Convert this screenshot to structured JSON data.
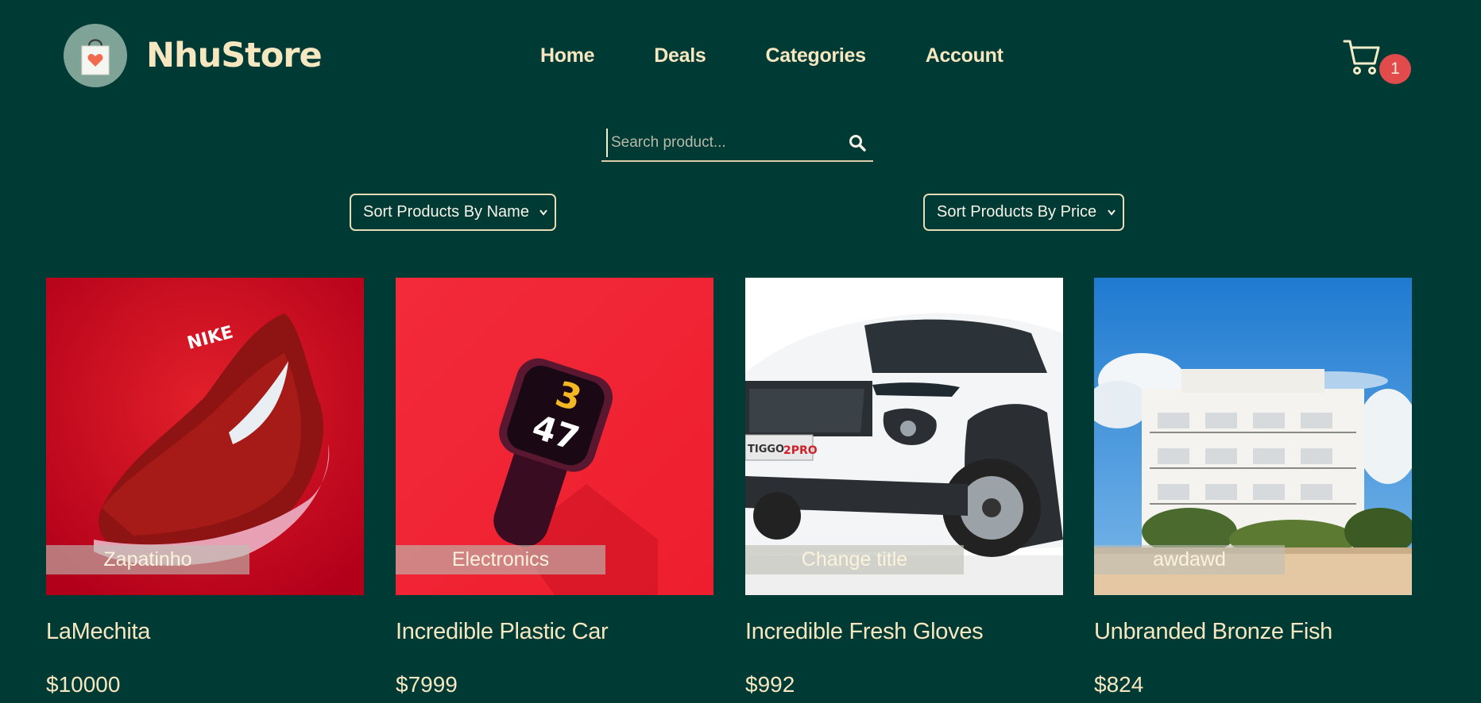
{
  "brand": {
    "name": "NhuStore"
  },
  "nav": {
    "items": [
      {
        "label": "Home"
      },
      {
        "label": "Deals"
      },
      {
        "label": "Categories"
      },
      {
        "label": "Account"
      }
    ]
  },
  "cart": {
    "count": "1"
  },
  "search": {
    "placeholder": "Search product...",
    "value": ""
  },
  "sort": {
    "by_name": "Sort Products By Name",
    "by_price": "Sort Products By Price"
  },
  "colors": {
    "background": "#003a35",
    "text": "#f6e7c0",
    "badge": "#e24b4b",
    "logo_circle": "#7fa497"
  },
  "products": [
    {
      "category": "Zapatinho",
      "name": "LaMechita",
      "price": "$10000",
      "image": "red sneaker on red background"
    },
    {
      "category": "Electronics",
      "name": "Incredible Plastic Car",
      "price": "$7999",
      "image": "smartwatch on red background"
    },
    {
      "category": "Change title",
      "name": "Incredible Fresh Gloves",
      "price": "$992",
      "image": "white SUV"
    },
    {
      "category": "awdawd",
      "name": "Unbranded Bronze Fish",
      "price": "$824",
      "image": "white apartment building under blue sky"
    }
  ]
}
